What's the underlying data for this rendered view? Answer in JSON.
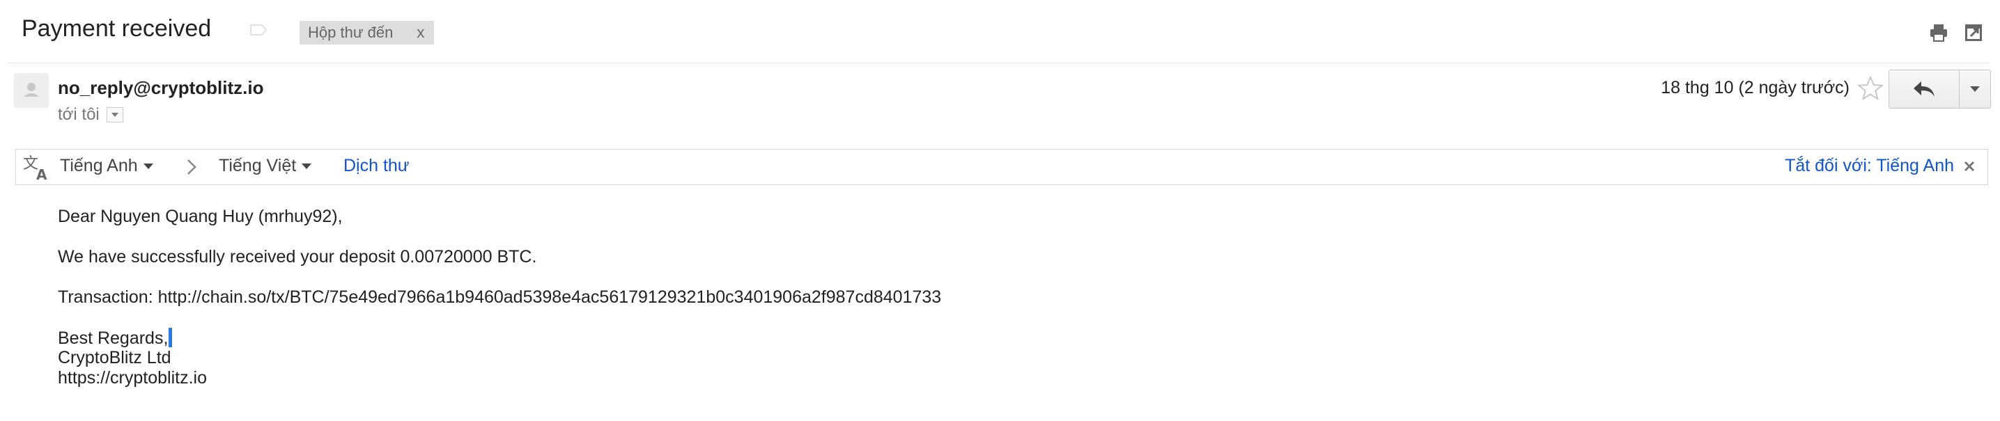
{
  "email": {
    "subject": "Payment received",
    "label_chip": "Hộp thư đến",
    "label_remove": "x",
    "sender": "no_reply@cryptoblitz.io",
    "to_line": "tới tôi",
    "date": "18 thg 10 (2 ngày trước)"
  },
  "translate_bar": {
    "source_lang": "Tiếng Anh",
    "target_lang": "Tiếng Việt",
    "translate_link": "Dịch thư",
    "turn_off_link": "Tắt đối với: Tiếng Anh"
  },
  "body": {
    "greeting": "Dear Nguyen Quang Huy (mrhuy92),",
    "line1": "We have successfully received your deposit 0.00720000 BTC.",
    "line2": "Transaction: http://chain.so/tx/BTC/75e49ed7966a1b9460ad5398e4ac56179129321b0c3401906a2f987cd8401733",
    "signoff": "Best Regards,",
    "company": "CryptoBlitz Ltd",
    "website": "https://cryptoblitz.io"
  },
  "icons": {
    "print": "print-icon",
    "new_window": "new-window-icon",
    "star": "star-icon",
    "reply": "reply-icon",
    "more": "chevron-down-icon",
    "translate": "translate-icon",
    "close": "close-icon",
    "important": "importance-marker-icon"
  },
  "colors": {
    "link": "#1155cc",
    "chip_bg": "#dddddd",
    "cursor": "#2a78e4"
  }
}
